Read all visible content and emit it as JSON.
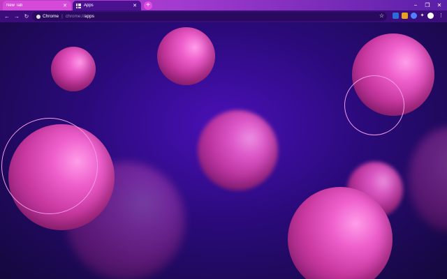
{
  "tabs": [
    {
      "title": "New Tab",
      "active": false
    },
    {
      "title": "Apps",
      "active": true
    }
  ],
  "omnibox": {
    "scheme_label": "Chrome",
    "url_prefix": "chrome://",
    "url_host": "apps"
  },
  "icons": {
    "close": "✕",
    "new_tab": "+",
    "back": "←",
    "forward": "→",
    "reload": "↻",
    "bookmark_star": "☆",
    "minimize": "−",
    "restore": "❐",
    "window_close": "✕",
    "menu": "⋮",
    "puzzle": "✦"
  },
  "colors": {
    "tabstrip": "#c13cc4",
    "toolbar": "#3b0d7a",
    "background": "#2a0a7a",
    "bubble": "#ee5fcc"
  }
}
